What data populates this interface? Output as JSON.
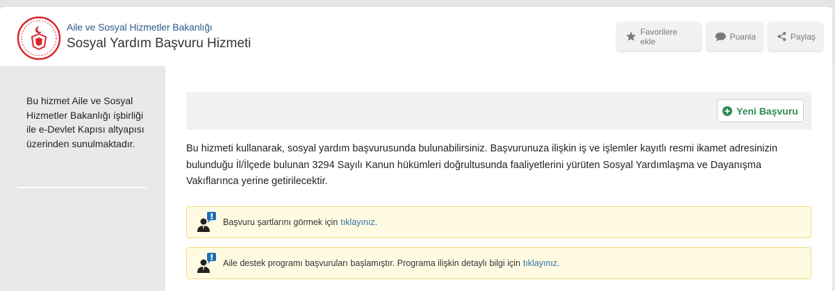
{
  "header": {
    "ministry": "Aile ve Sosyal Hizmetler Bakanlığı",
    "service_title": "Sosyal Yardım Başvuru Hizmeti",
    "buttons": {
      "favorites": "Favorilere ekle",
      "rate": "Puanla",
      "share": "Paylaş"
    },
    "brand_color": "#d9232d"
  },
  "sidebar": {
    "description": "Bu hizmet Aile ve Sosyal Hizmetler Bakanlığı işbirliği ile e-Devlet Kapısı altyapısı üzerinden sunulmaktadır."
  },
  "main": {
    "new_application_label": "Yeni Başvuru",
    "intro": "Bu hizmeti kullanarak, sosyal yardım başvurusunda bulunabilirsiniz. Başvurunuza ilişkin iş ve işlemler kayıtlı resmi ikamet adresinizin bulunduğu İl/İlçede bulunan 3294 Sayılı Kanun hükümleri doğrultusunda faaliyetlerini yürüten Sosyal Yardımlaşma ve Dayanışma Vakıflarınca yerine getirilecektir.",
    "alerts": [
      {
        "text": "Başvuru şartlarını görmek için",
        "link": "tıklayınız",
        "suffix": "."
      },
      {
        "text": "Aile destek programı başvuruları başlamıştır. Programa ilişkin detaylı bilgi için",
        "link": "tıklayınız",
        "suffix": "."
      }
    ]
  }
}
